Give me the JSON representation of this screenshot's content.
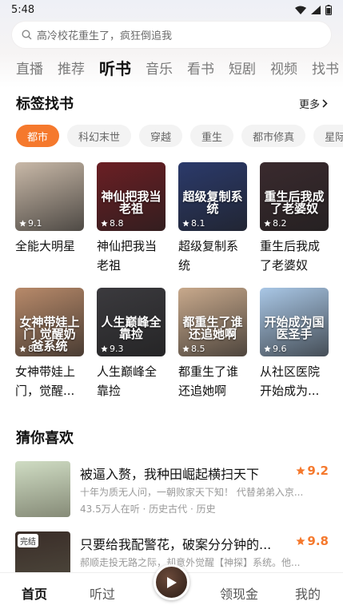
{
  "status": {
    "time": "5:48"
  },
  "search": {
    "placeholder": "高冷校花重生了，疯狂倒追我"
  },
  "channels": [
    "直播",
    "推荐",
    "听书",
    "音乐",
    "看书",
    "短剧",
    "视频",
    "找书"
  ],
  "channels_active_index": 2,
  "tag_section": {
    "title": "标签找书",
    "more": "更多",
    "tags": [
      "都市",
      "科幻末世",
      "穿越",
      "重生",
      "都市修真",
      "星际"
    ],
    "active_tag_index": 0
  },
  "books": [
    {
      "name": "全能大明星",
      "rating": "9.1",
      "cover_text": "",
      "cover_color": "#c9b9a8"
    },
    {
      "name": "神仙把我当老祖",
      "rating": "8.8",
      "cover_text": "神仙把我当老祖",
      "cover_color": "#6b1f24"
    },
    {
      "name": "超级复制系统",
      "rating": "8.1",
      "cover_text": "超级复制系统",
      "cover_color": "#2b3a6b"
    },
    {
      "name": "重生后我成了老婆奴",
      "rating": "8.2",
      "cover_text": "重生后我成了老婆奴",
      "cover_color": "#3a2a2e"
    },
    {
      "name": "女神带娃上门，觉醒...",
      "rating": "8.9",
      "cover_text": "女神带娃上门 觉醒奶爸系统",
      "cover_color": "#b88a6a"
    },
    {
      "name": "人生巅峰全靠捡",
      "rating": "9.3",
      "cover_text": "人生巅峰全靠捡",
      "cover_color": "#3b3a3e"
    },
    {
      "name": "都重生了谁还追她啊",
      "rating": "8.5",
      "cover_text": "都重生了谁还追她啊",
      "cover_color": "#c8a98c"
    },
    {
      "name": "从社区医院开始成为...",
      "rating": "9.6",
      "cover_text": "开始成为国医圣手",
      "cover_color": "#a9c7e6"
    }
  ],
  "recommend": {
    "title": "猜你喜欢",
    "items": [
      {
        "title": "被逼入赘，我种田崛起横扫天下",
        "score": "9.2",
        "desc": "十年为质无人问，一朝败家天下知！ 代替弟弟入京...",
        "meta": "43.5万人在听 · 历史古代 · 历史",
        "badge": "",
        "cover_color": "#cfdcc3"
      },
      {
        "title": "只要给我配警花，破案分分钟的...",
        "score": "9.8",
        "desc": "郝顺走投无路之际，却意外觉醒【神探】系统。他...",
        "meta": "",
        "badge": "完结",
        "cover_color": "#3a2d28"
      }
    ]
  },
  "bottom_nav": {
    "home": "首页",
    "listened": "听过",
    "cash": "领现金",
    "mine": "我的"
  },
  "colors": {
    "accent": "#f5792d"
  }
}
